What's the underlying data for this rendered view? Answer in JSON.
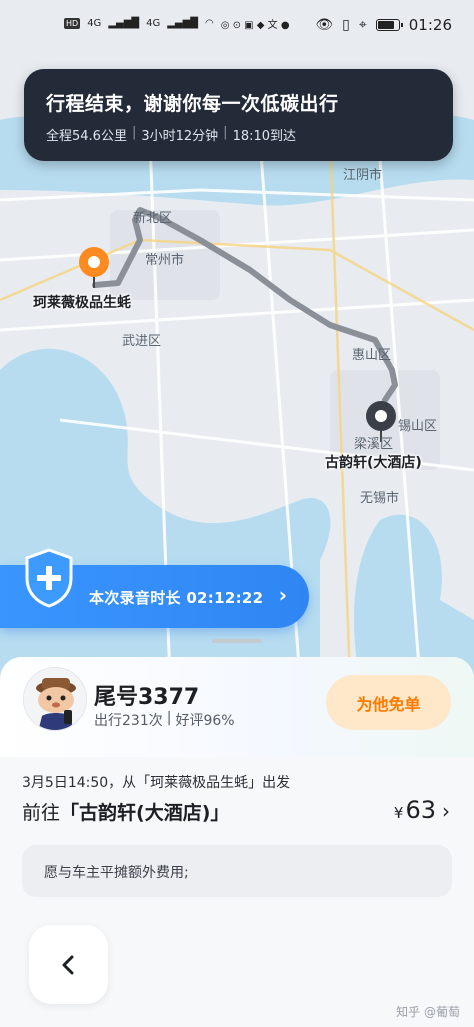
{
  "status_bar": {
    "left_indicators": [
      "HD",
      "HD",
      "4G",
      "4G"
    ],
    "time": "01:26",
    "battery_level": 0.85
  },
  "trip_banner": {
    "title": "行程结束，谢谢你每一次低碳出行",
    "distance": "全程54.6公里",
    "duration": "3小时12分钟",
    "arrival": "18:10到达"
  },
  "map": {
    "labels": {
      "jiangyin": "江阴市",
      "xinbei": "新北区",
      "changzhou": "常州市",
      "wujin": "武进区",
      "huishan": "惠山区",
      "xishan": "锡山区",
      "liangxi": "梁溪区",
      "wuxi": "无锡市"
    },
    "origin_name": "珂莱薇极品生蚝",
    "destination_name": "古韵轩(大酒店)"
  },
  "recording": {
    "label": "本次录音时长 02:12:22",
    "icon": "shield-plus-icon",
    "color": "#2f86f3"
  },
  "driver": {
    "plate_tail": "尾号3377",
    "trips": "出行231次",
    "rating": "好评96%",
    "free_button_label": "为他免单"
  },
  "trip": {
    "start_text": "3月5日14:50，从「珂莱薇极品生蚝」出发",
    "dest_prefix": "前往",
    "dest_name": "「古韵轩(大酒店)」",
    "fare_symbol": "¥",
    "fare_value": "63"
  },
  "fee_note": "愿与车主平摊额外费用;",
  "watermark": "知乎 @葡萄",
  "colors": {
    "accent_blue": "#2f86f3",
    "orange": "#ff7a00",
    "banner_bg": "#232b38"
  }
}
